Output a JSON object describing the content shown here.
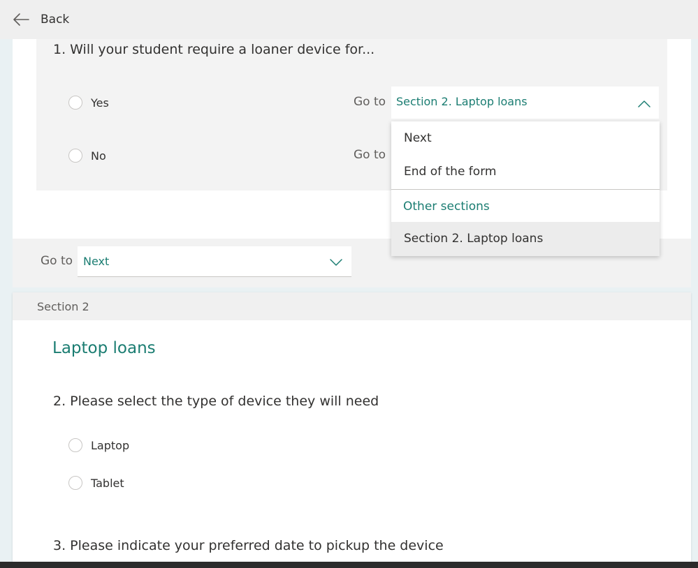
{
  "nav": {
    "back_label": "Back",
    "back_icon": "arrow-left-icon"
  },
  "section1": {
    "question1": {
      "title": "1. Will your student require a loaner device for...",
      "options": [
        {
          "label": "Yes",
          "goto_label": "Go to",
          "goto_value": "Section 2. Laptop loans"
        },
        {
          "label": "No",
          "goto_label": "Go to"
        }
      ]
    },
    "branch_menu": {
      "items": [
        "Next",
        "End of the form"
      ],
      "group_label": "Other sections",
      "group_items": [
        "Section 2. Laptop loans"
      ]
    },
    "section_goto": {
      "label": "Go to",
      "value": "Next"
    }
  },
  "section2": {
    "header_label": "Section 2",
    "title": "Laptop loans",
    "question2": {
      "title": "2. Please select the type of device they will need",
      "options": [
        "Laptop",
        "Tablet"
      ]
    },
    "question3": {
      "title": "3. Please indicate your preferred date to pickup the device"
    }
  },
  "colors": {
    "accent": "#1b7d72",
    "text": "#323130",
    "muted": "#605e5c",
    "page_bg": "#e9f1f3"
  }
}
